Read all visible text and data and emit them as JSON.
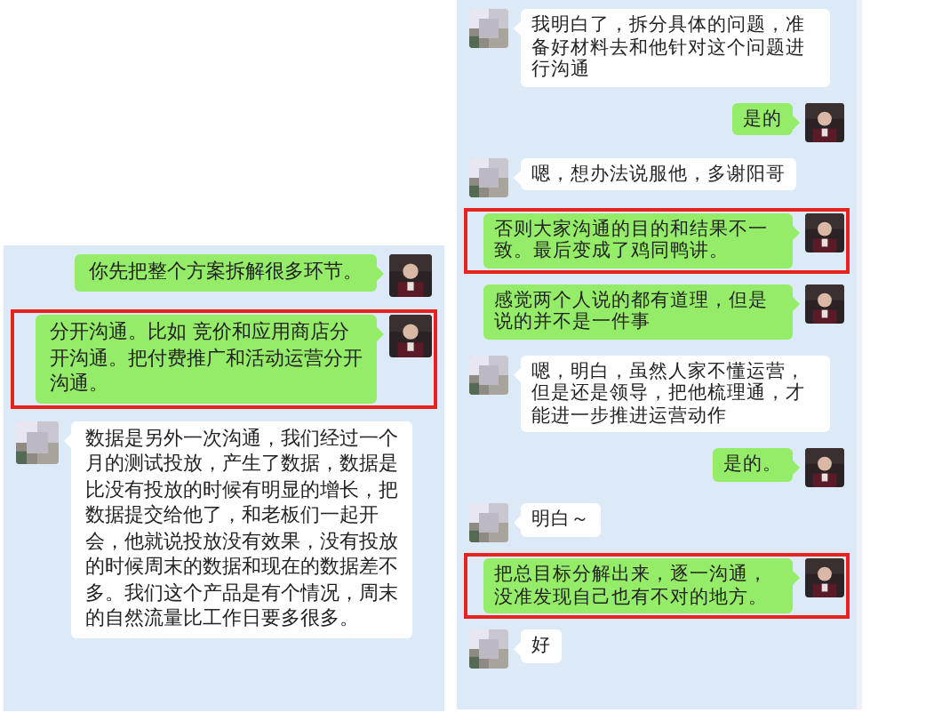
{
  "panels": [
    {
      "messages": [
        {
          "kind": "me",
          "text": "你先把整个方案拆解很多环节。",
          "highlighted": false
        },
        {
          "kind": "me",
          "text": "分开沟通。比如 竞价和应用商店分开沟通。把付费推广和活动运营分开沟通。",
          "highlighted": true
        },
        {
          "kind": "other",
          "text": "数据是另外一次沟通，我们经过一个月的测试投放，产生了数据，数据是比没有投放的时候有明显的增长，把数据提交给他了，和老板们一起开会，他就说投放没有效果，没有投放的时候周末的数据和现在的数据差不多。我们这个产品是有个情况，周末的自然流量比工作日要多很多。",
          "highlighted": false
        }
      ]
    },
    {
      "messages": [
        {
          "kind": "other",
          "text": "我明白了，拆分具体的问题，准备好材料去和他针对这个问题进行沟通",
          "highlighted": false
        },
        {
          "kind": "me",
          "text": "是的",
          "highlighted": false
        },
        {
          "kind": "other",
          "text": "嗯，想办法说服他，多谢阳哥",
          "highlighted": false
        },
        {
          "kind": "me",
          "text": "否则大家沟通的目的和结果不一致。最后变成了鸡同鸭讲。",
          "highlighted": true
        },
        {
          "kind": "me",
          "text": "感觉两个人说的都有道理，但是说的并不是一件事",
          "highlighted": false
        },
        {
          "kind": "other",
          "text": "嗯，明白，虽然人家不懂运营，但是还是领导，把他梳理通，才能进一步推进运营动作",
          "highlighted": false
        },
        {
          "kind": "me",
          "text": "是的。",
          "highlighted": false
        },
        {
          "kind": "other",
          "text": "明白～",
          "highlighted": false
        },
        {
          "kind": "me",
          "text": "把总目标分解出来，逐一沟通，没准发现自己也有不对的地方。",
          "highlighted": true
        },
        {
          "kind": "other",
          "text": "好",
          "highlighted": false
        }
      ]
    }
  ]
}
